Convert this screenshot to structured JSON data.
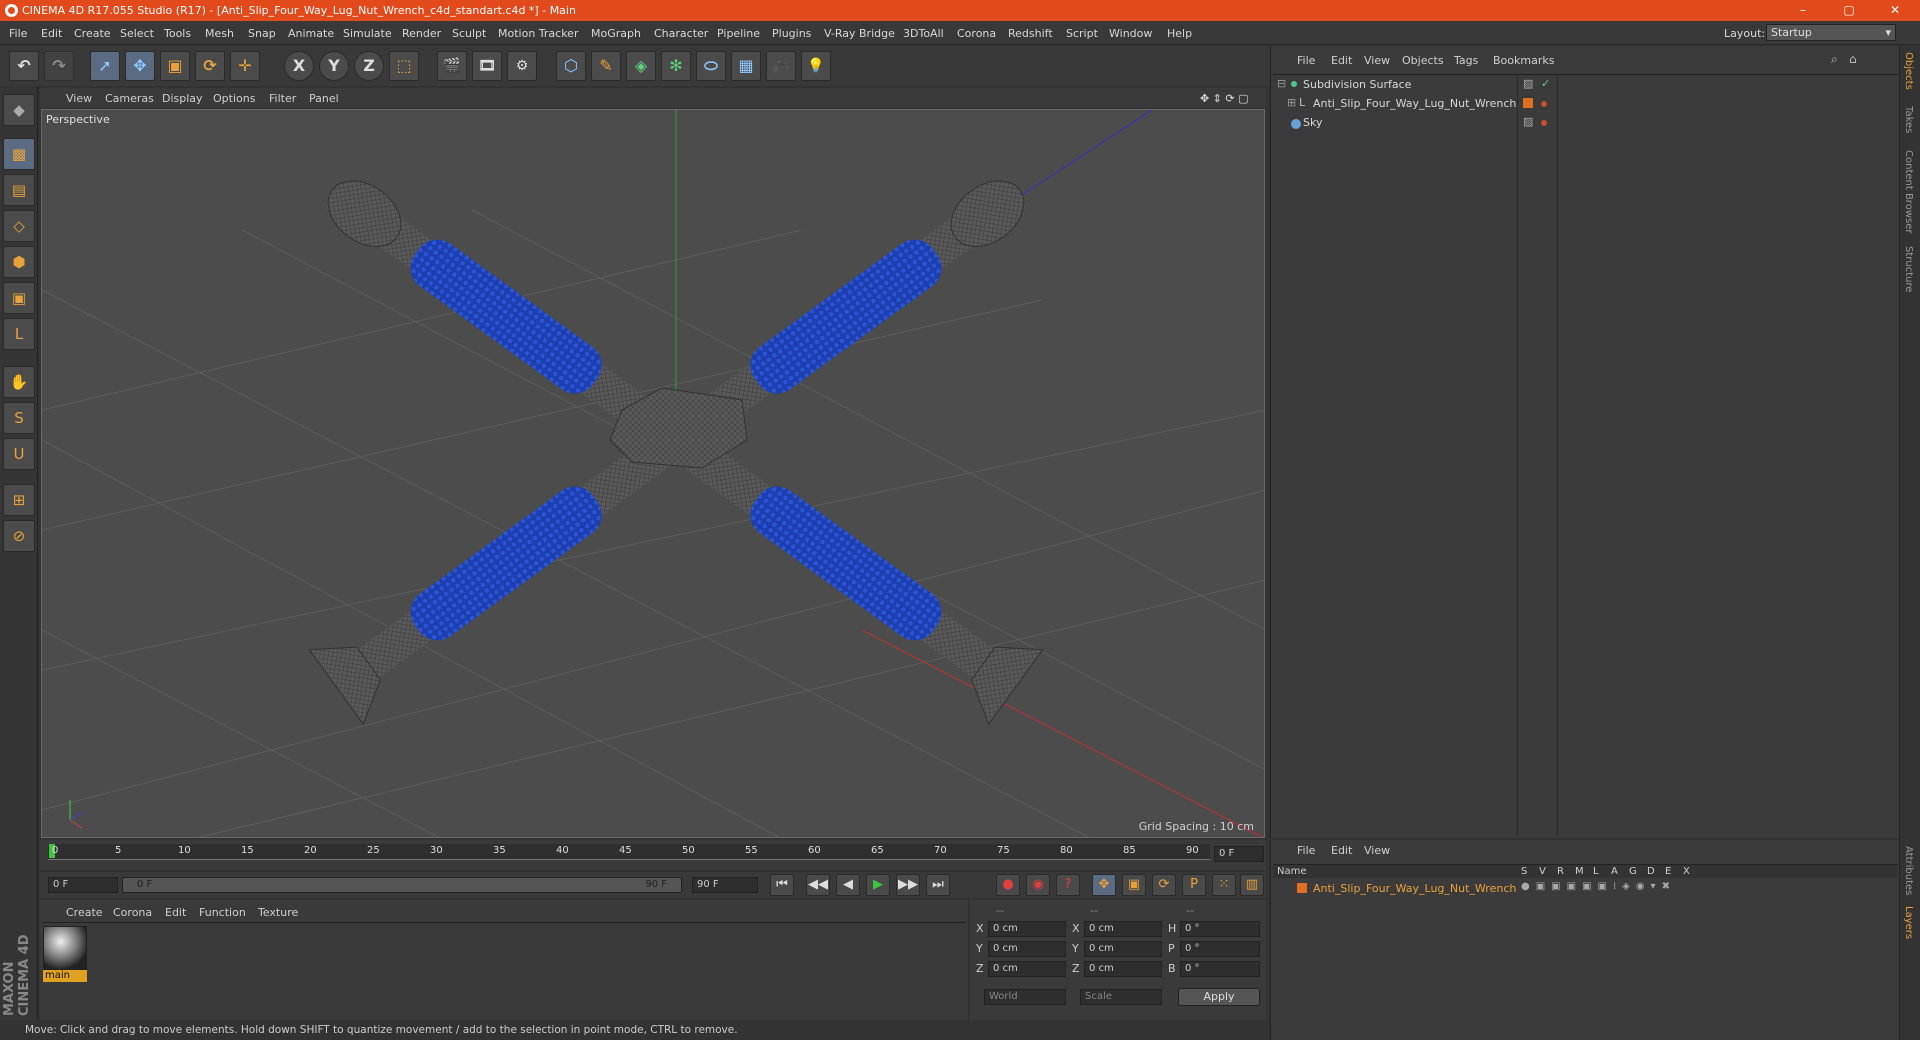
{
  "window": {
    "title": "CINEMA 4D R17.055 Studio (R17) - [Anti_Slip_Four_Way_Lug_Nut_Wrench_c4d_standart.c4d *] - Main",
    "min": "–",
    "max": "▢",
    "close": "✕"
  },
  "menu": [
    "File",
    "Edit",
    "Create",
    "Select",
    "Tools",
    "Mesh",
    "Snap",
    "Animate",
    "Simulate",
    "Render",
    "Sculpt",
    "Motion Tracker",
    "MoGraph",
    "Character",
    "Pipeline",
    "Plugins",
    "V-Ray Bridge",
    "3DToAll",
    "Corona",
    "Redshift",
    "Script",
    "Window",
    "Help"
  ],
  "layout": {
    "label": "Layout:",
    "value": "Startup"
  },
  "toolbar": {
    "undo": "↶",
    "redo": "↷",
    "select": "➚",
    "move": "✥",
    "scale": "▣",
    "rotate": "⟳",
    "transform": "✛",
    "axis_x": "X",
    "axis_y": "Y",
    "axis_z": "Z",
    "coord": "⬚",
    "render_view": "🎬",
    "render": "🎞",
    "render_settings": "⚙",
    "cube": "⬡",
    "pen": "✎",
    "subdiv": "◈",
    "array": "✻",
    "deform": "⬭",
    "floor": "▦",
    "camera": "🎥",
    "light": "💡"
  },
  "left_tools": [
    "◆",
    "▩",
    "▤",
    "◇",
    "⬢",
    "▣",
    "L",
    "✋",
    "S",
    "U",
    "⊞",
    "⊘"
  ],
  "viewport": {
    "menu": [
      "View",
      "Cameras",
      "Display",
      "Options",
      "Filter",
      "Panel"
    ],
    "label": "Perspective",
    "grid_spacing": "Grid Spacing : 10 cm",
    "nav_icons": "✥ ⇕ ⟳ ▢"
  },
  "timeline": {
    "ticks": [
      "0",
      "5",
      "10",
      "15",
      "20",
      "25",
      "30",
      "35",
      "40",
      "45",
      "50",
      "55",
      "60",
      "65",
      "70",
      "75",
      "80",
      "85",
      "90"
    ],
    "current": "0 F"
  },
  "controls": {
    "start": "0 F",
    "range_start": "0 F",
    "range_end": "90 F",
    "end": "90 F",
    "buttons": [
      "⏮",
      "◀◀",
      "◀",
      "▶",
      "▶▶",
      "⏭"
    ]
  },
  "material": {
    "menu": [
      "Create",
      "Corona",
      "Edit",
      "Function",
      "Texture"
    ],
    "swatch_label": "main"
  },
  "coords": {
    "headers": [
      "--",
      "--",
      "--"
    ],
    "rows": [
      {
        "a": "X",
        "v1": "0 cm",
        "b": "X",
        "v2": "0 cm",
        "c": "H",
        "v3": "0 °"
      },
      {
        "a": "Y",
        "v1": "0 cm",
        "b": "Y",
        "v2": "0 cm",
        "c": "P",
        "v3": "0 °"
      },
      {
        "a": "Z",
        "v1": "0 cm",
        "b": "Z",
        "v2": "0 cm",
        "c": "B",
        "v3": "0 °"
      }
    ],
    "world": "World",
    "scale": "Scale",
    "apply": "Apply"
  },
  "objects": {
    "menu": [
      "File",
      "Edit",
      "View",
      "Objects",
      "Tags",
      "Bookmarks"
    ],
    "items": [
      {
        "name": "Subdivision Surface",
        "color": "#4fc78a"
      },
      {
        "name": "Anti_Slip_Four_Way_Lug_Nut_Wrench",
        "color": "#e07020"
      },
      {
        "name": "Sky",
        "color": "#6aa0d8"
      }
    ]
  },
  "layers": {
    "menu": [
      "File",
      "Edit",
      "View"
    ],
    "name_header": "Name",
    "cols": [
      "S",
      "V",
      "R",
      "M",
      "L",
      "A",
      "G",
      "D",
      "E",
      "X"
    ],
    "item": "Anti_Slip_Four_Way_Lug_Nut_Wrench"
  },
  "right_tabs": [
    "Objects",
    "Takes",
    "Content Browser",
    "Structure",
    "Attributes",
    "Layers"
  ],
  "brand": "MAXON CINEMA 4D",
  "status": "Move: Click and drag to move elements. Hold down SHIFT to quantize movement / add to the selection in point mode, CTRL to remove."
}
